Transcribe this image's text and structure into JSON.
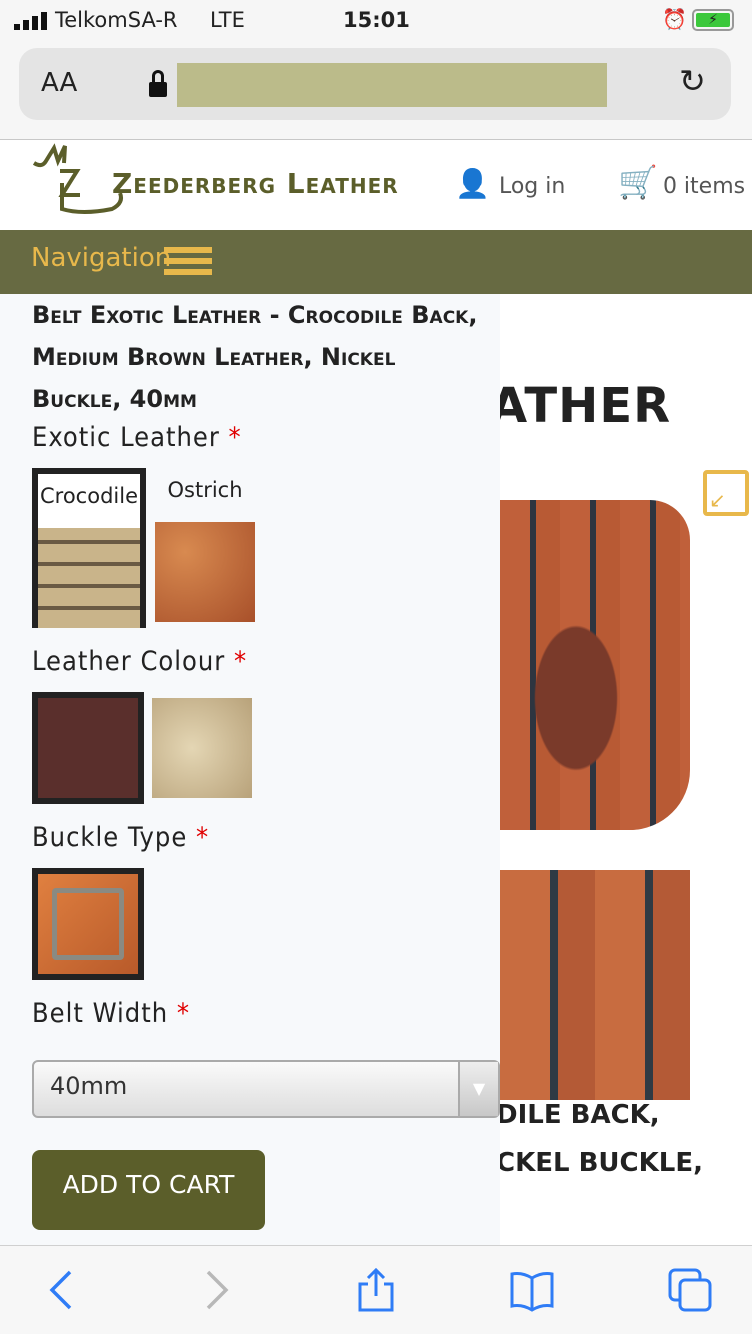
{
  "status_bar": {
    "carrier": "TelkomSA-R",
    "network": "LTE",
    "time": "15:01"
  },
  "browser": {
    "text_size_label": "AA",
    "url": "",
    "icons": [
      "lock-icon",
      "reload-icon"
    ]
  },
  "site": {
    "brand": "Zeederberg Leather",
    "login": "Log in",
    "cart": "0 items",
    "navigation": "Navigation",
    "colors": {
      "nav_bg": "#676a42",
      "nav_text": "#e8b84b",
      "brand": "#5b5e2a"
    }
  },
  "background": {
    "heading_fragment": "ATHER",
    "title_fragment_1": "DILE BACK,",
    "title_fragment_2": "CKEL BUCKLE,"
  },
  "product": {
    "title": "Belt Exotic Leather - Crocodile Back, Medium Brown Leather, Nickel Buckle, 40mm",
    "exotic_leather": {
      "label": "Exotic Leather",
      "required": "*",
      "options": [
        {
          "name": "Crocodile",
          "selected": true
        },
        {
          "name": "Ostrich",
          "selected": false
        }
      ]
    },
    "leather_colour": {
      "label": "Leather Colour",
      "required": "*",
      "selected_index": 0
    },
    "buckle_type": {
      "label": "Buckle Type",
      "required": "*",
      "selected_index": 0
    },
    "belt_width": {
      "label": "Belt Width",
      "required": "*",
      "value": "40mm"
    },
    "add_to_cart": "ADD TO CART"
  }
}
